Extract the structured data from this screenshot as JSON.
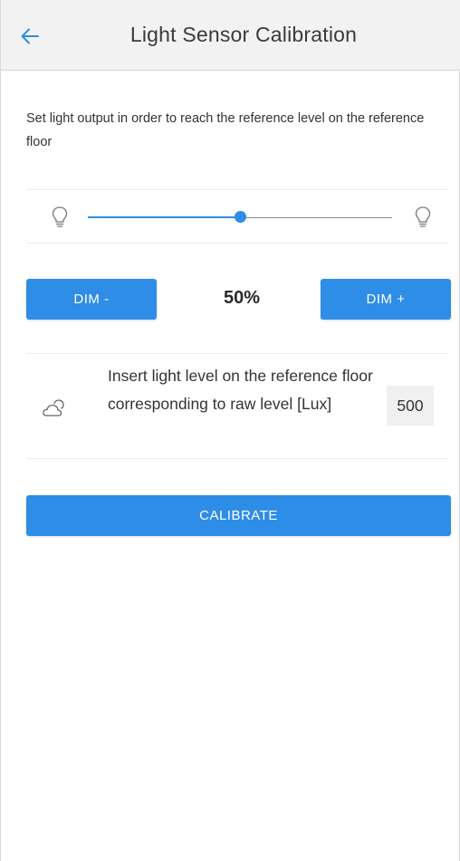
{
  "header": {
    "title": "Light Sensor Calibration",
    "back_icon": "arrow-left-icon"
  },
  "instruction": "Set light output in order to reach the reference level on the reference floor",
  "slider": {
    "value_fraction": 0.5,
    "min_icon": "lightbulb-outline-icon",
    "max_icon": "lightbulb-outline-icon"
  },
  "dim": {
    "minus_label": "DIM -",
    "plus_label": "DIM +",
    "percent_text": "50%"
  },
  "lux": {
    "icon": "cloud-sun-icon",
    "label": "Insert light level on the reference floor corresponding to raw level [Lux]",
    "value": "500"
  },
  "calibrate_label": "CALIBRATE",
  "colors": {
    "accent": "#2e8de6",
    "appbar_bg": "#f2f2f2",
    "input_bg": "#f0f0f0"
  }
}
